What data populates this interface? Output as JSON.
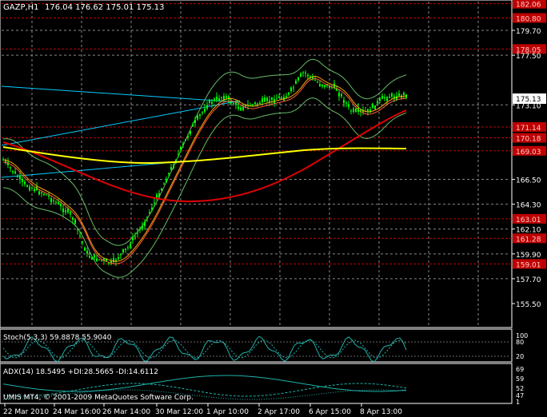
{
  "header": {
    "symbol": "GAZP,H1",
    "ohlc": "176.04 176.62 175.01 175.13"
  },
  "stoch_label": "Stoch(5,3,3) 59.8878 55.9040",
  "adx_label": "ADX(14) 18.5495 +DI:28.5665 -DI:14.6112",
  "watermark": "UMIS MT4, © 2001-2009 MetaQuotes Software Corp.",
  "price_labels": [
    {
      "value": "182.06",
      "color": "#c00000"
    },
    {
      "value": "180.80",
      "color": "#c00000"
    },
    {
      "value": "179.70",
      "color": "#ffffff"
    },
    {
      "value": "178.05",
      "color": "#c00000"
    },
    {
      "value": "177.50",
      "color": "#ffffff"
    },
    {
      "value": "173.10",
      "color": "#ffffff"
    },
    {
      "value": "171.14",
      "color": "#c00000"
    },
    {
      "value": "170.18",
      "color": "#c00000"
    },
    {
      "value": "169.03",
      "color": "#c00000"
    },
    {
      "value": "166.50",
      "color": "#ffffff"
    },
    {
      "value": "164.30",
      "color": "#ffffff"
    },
    {
      "value": "163.01",
      "color": "#c00000"
    },
    {
      "value": "162.10",
      "color": "#ffffff"
    },
    {
      "value": "161.28",
      "color": "#c00000"
    },
    {
      "value": "159.90",
      "color": "#ffffff"
    },
    {
      "value": "159.01",
      "color": "#c00000"
    },
    {
      "value": "157.70",
      "color": "#ffffff"
    },
    {
      "value": "155.50",
      "color": "#ffffff"
    }
  ],
  "current_price": "175.13",
  "stoch_scale": [
    "100",
    "80",
    "20"
  ],
  "adx_scale": [
    "69",
    "59",
    "52",
    "47",
    "1"
  ],
  "date_labels": [
    "22 Mar 2010",
    "24 Mar 16:00",
    "26 Mar 14:00",
    "30 Mar 12:00",
    "1 Apr 10:00",
    "2 Apr 17:00",
    "6 Apr 15:00",
    "8 Apr 13:00"
  ],
  "colors": {
    "background": "#000000",
    "candle": "#00ff00",
    "support_resistance": "#c00000",
    "ma_slow": "#e00000",
    "ma_very_slow": "#ffff00",
    "ma_fast": "#ffa500",
    "bollinger": "#66bb66",
    "trendline": "#00ccff",
    "oscillator": "#20b2aa"
  }
}
